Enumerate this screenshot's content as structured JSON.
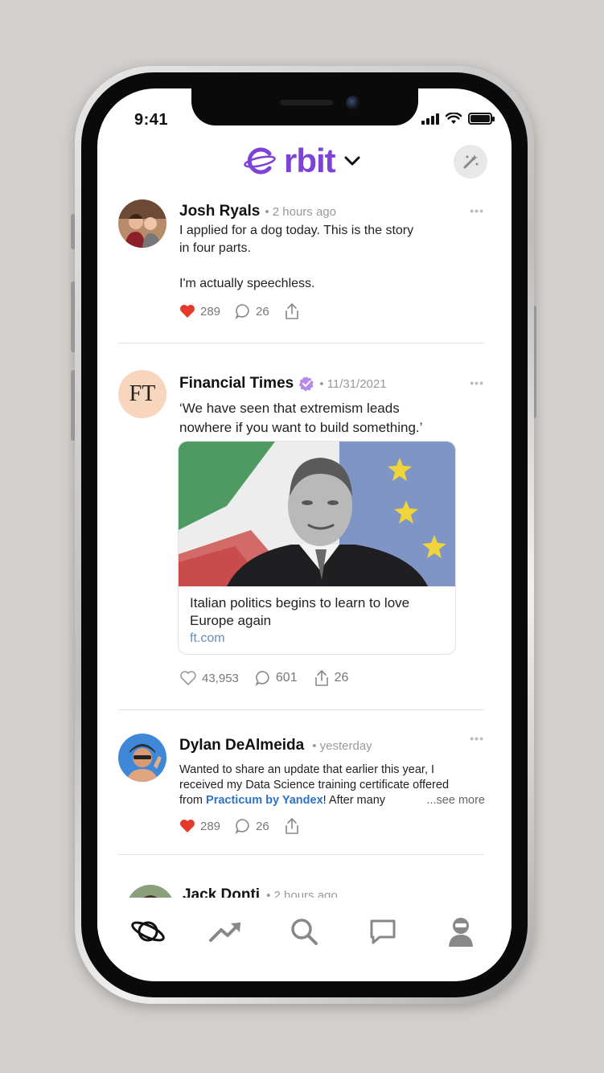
{
  "status": {
    "time": "9:41"
  },
  "header": {
    "logo_text": "rbit"
  },
  "posts": [
    {
      "author": "Josh Ryals",
      "time": "• 2 hours ago",
      "text_lines": [
        "I applied for a dog today. This is the story",
        "in four parts.",
        "",
        "I'm actually speechless."
      ],
      "likes": "289",
      "comments": "26",
      "liked": true
    },
    {
      "author": "Financial Times",
      "avatar_text": "FT",
      "verified": true,
      "time": "• 11/31/2021",
      "text_lines": [
        "‘We have seen that extremism leads",
        "nowhere if you want to build something.’"
      ],
      "card": {
        "title": "Italian politics begins to learn to love Europe again",
        "domain": "ft.com"
      },
      "likes": "43,953",
      "comments": "601",
      "shares": "26",
      "liked": false
    },
    {
      "author": "Dylan DeAlmeida",
      "time": "• yesterday",
      "text_line1": "Wanted to share an update that earlier this year, I",
      "text_line2": "received my Data Science training certificate offered",
      "text_line3_prefix": "from ",
      "text_link": "Practicum by Yandex",
      "text_line3_suffix": "! After many",
      "see_more": "...see more",
      "likes": "289",
      "comments": "26",
      "liked": true
    },
    {
      "author": "Jack Donti",
      "time": "• 2 hours ago"
    }
  ],
  "colors": {
    "brand": "#7d43d6",
    "like": "#e53a2a",
    "verified": "#b48bea",
    "link": "#2f72c8"
  },
  "tabs": [
    "explore-icon",
    "trending-icon",
    "search-icon",
    "messages-icon",
    "profile-icon"
  ]
}
